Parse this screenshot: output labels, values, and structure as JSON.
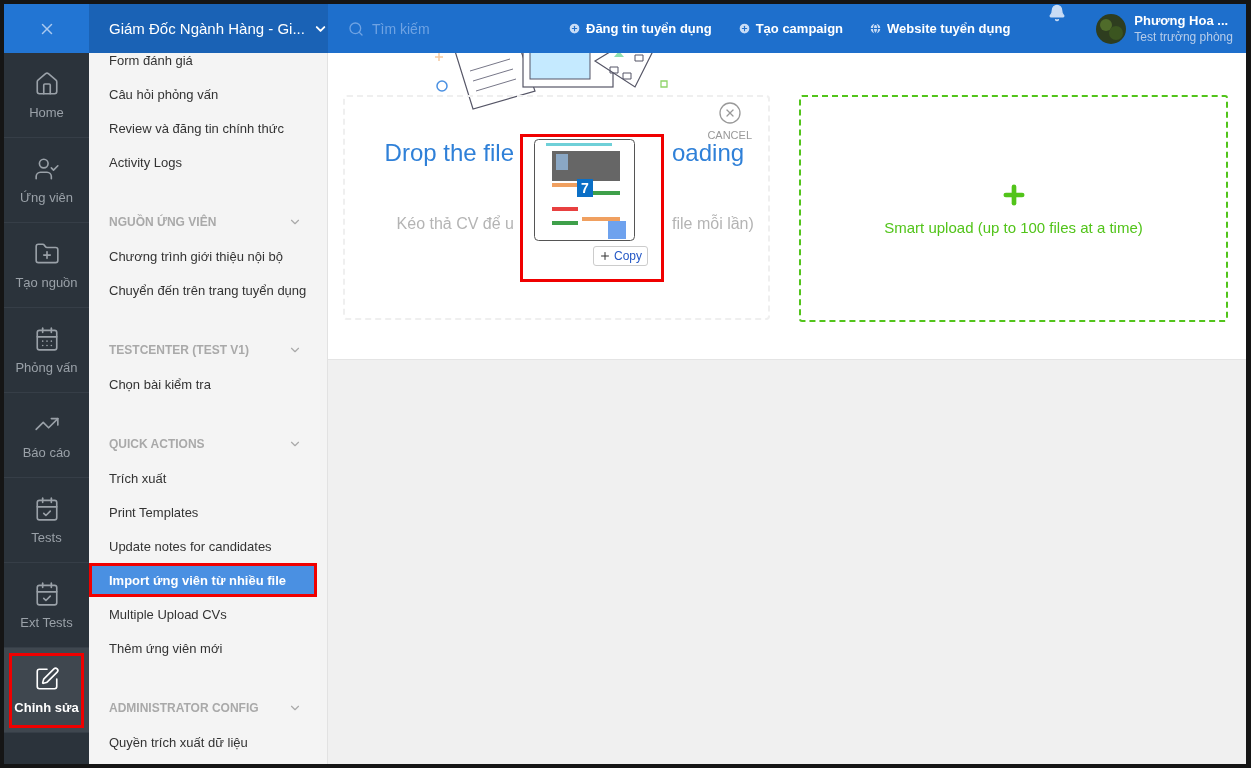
{
  "topbar": {
    "workspace": "Giám Đốc Ngành Hàng - Gi...",
    "search": {
      "placeholder": "Tìm kiếm"
    },
    "links": [
      "Đăng tin tuyển dụng",
      "Tạo campaign",
      "Website tuyển dụng"
    ],
    "user": {
      "name": "Phương Hoa ...",
      "role": "Test trưởng phòng"
    }
  },
  "rail": [
    {
      "label": "Home",
      "selected": false,
      "annotated": false
    },
    {
      "label": "Ứng viên",
      "selected": false,
      "annotated": false
    },
    {
      "label": "Tạo nguồn",
      "selected": false,
      "annotated": false
    },
    {
      "label": "Phỏng vấn",
      "selected": false,
      "annotated": false
    },
    {
      "label": "Báo cáo",
      "selected": false,
      "annotated": false
    },
    {
      "label": "Tests",
      "selected": false,
      "annotated": false
    },
    {
      "label": "Ext Tests",
      "selected": false,
      "annotated": false
    },
    {
      "label": "Chỉnh sửa",
      "selected": true,
      "annotated": true
    }
  ],
  "menu": [
    {
      "items": [
        {
          "label": "Form đánh giá",
          "selected": false,
          "annotated": false
        },
        {
          "label": "Câu hỏi phỏng vấn",
          "selected": false,
          "annotated": false
        },
        {
          "label": "Review và đăng tin chính thức",
          "selected": false,
          "annotated": false
        },
        {
          "label": "Activity Logs",
          "selected": false,
          "annotated": false
        }
      ]
    },
    {
      "title": "NGUỒN ỨNG VIÊN",
      "expanded": true,
      "items": [
        {
          "label": "Chương trình giới thiệu nội bộ",
          "selected": false,
          "annotated": false
        },
        {
          "label": "Chuyển đến trên trang tuyển dụng",
          "selected": false,
          "annotated": false
        }
      ]
    },
    {
      "title": "TESTCENTER (TEST V1)",
      "expanded": true,
      "items": [
        {
          "label": "Chọn bài kiểm tra",
          "selected": false,
          "annotated": false
        }
      ]
    },
    {
      "title": "QUICK ACTIONS",
      "expanded": true,
      "items": [
        {
          "label": "Trích xuất",
          "selected": false,
          "annotated": false
        },
        {
          "label": "Print Templates",
          "selected": false,
          "annotated": false
        },
        {
          "label": "Update notes for candidates",
          "selected": false,
          "annotated": false
        },
        {
          "label": "Import ứng viên từ nhiều file",
          "selected": true,
          "annotated": true
        },
        {
          "label": "Multiple Upload CVs",
          "selected": false,
          "annotated": false
        },
        {
          "label": "Thêm ứng viên mới",
          "selected": false,
          "annotated": false
        }
      ]
    },
    {
      "title": "ADMINISTRATOR CONFIG",
      "expanded": true,
      "items": [
        {
          "label": "Quyền trích xuất dữ liệu",
          "selected": false,
          "annotated": false
        }
      ]
    }
  ],
  "upload": {
    "heading_start": "Drop the file",
    "heading_end": "oading",
    "hint_start": "Kéo thả CV để u",
    "hint_end": "file mỗi lần)",
    "cancel": "CANCEL",
    "drag": {
      "count": "7",
      "action": "Copy",
      "annotated": true
    }
  },
  "smart_upload": {
    "label": "Smart upload (up to 100 files at a time)"
  }
}
